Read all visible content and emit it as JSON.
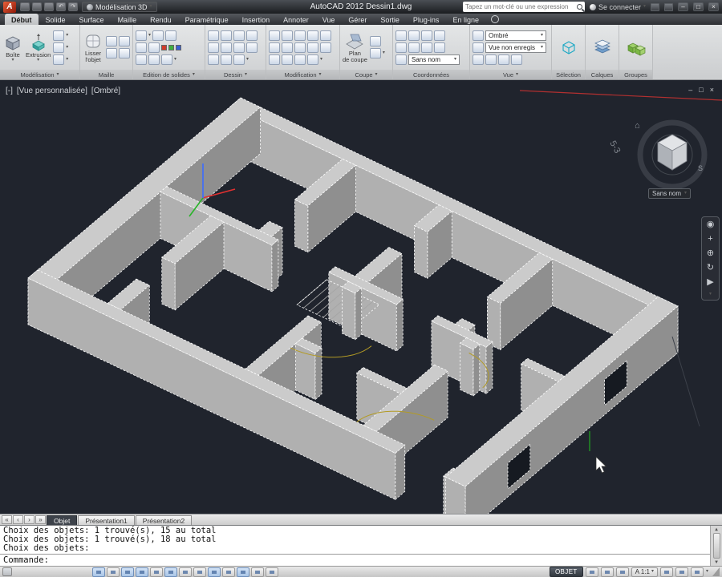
{
  "title_bar": {
    "workspace": "Modélisation 3D",
    "app_name": "AutoCAD 2012",
    "doc_name": "Dessin1.dwg",
    "search_placeholder": "Tapez un mot-clé ou une expression",
    "sign_in": "Se connecter"
  },
  "ribbon": {
    "tabs": [
      "Début",
      "Solide",
      "Surface",
      "Maille",
      "Rendu",
      "Paramétrique",
      "Insertion",
      "Annoter",
      "Vue",
      "Gérer",
      "Sortie",
      "Plug-ins",
      "En ligne"
    ],
    "panels": {
      "modelisation": {
        "label": "Modélisation",
        "box": "Boîte",
        "extrusion": "Extrusion"
      },
      "maille": {
        "label": "Maille",
        "smooth_line1": "Lisser",
        "smooth_line2": "l'objet"
      },
      "edition": {
        "label": "Edition de solides"
      },
      "dessin": {
        "label": "Dessin"
      },
      "modification": {
        "label": "Modification"
      },
      "coupe": {
        "label": "Coupe",
        "section_line1": "Plan",
        "section_line2": "de coupe"
      },
      "coordonnees": {
        "label": "Coordonnées",
        "ucs_value": "Sans nom"
      },
      "vue": {
        "label": "Vue",
        "visual_style": "Ombré",
        "named_view": "Vue non enregis"
      },
      "selection": {
        "label": "Sélection"
      },
      "calques": {
        "label": "Calques"
      },
      "groupes": {
        "label": "Groupes"
      }
    }
  },
  "viewport": {
    "controls_label": "[-]",
    "view_label": "[Vue personnalisée]",
    "style_label": "[Ombré]",
    "section_label": "5-3",
    "ucs_tag": "Sans nom",
    "compass_s": "S"
  },
  "layout_tabs": {
    "items": [
      "Objet",
      "Présentation1",
      "Présentation2"
    ]
  },
  "command": {
    "lines": [
      "Choix des objets: 1 trouvé(s), 15 au total",
      "Choix des objets: 1 trouvé(s), 18 au total",
      "Choix des objets:"
    ],
    "prompt": "Commande:"
  },
  "status_bar": {
    "model_label": "OBJET",
    "scale_label": "A 1:1"
  },
  "icons": {
    "caret": "▾",
    "minimize": "–",
    "maximize": "□",
    "close": "×",
    "undo": "↶",
    "redo": "↷",
    "home": "⌂",
    "nav_wheel": "◉",
    "nav_pan": "+",
    "nav_zoom": "⊕",
    "nav_orbit": "↻",
    "nav_motion": "▶",
    "arrow_first": "«",
    "arrow_prev": "‹",
    "arrow_next": "›",
    "arrow_last": "»",
    "scroll_up": "▲",
    "scroll_down": "▼"
  },
  "colors": {
    "viewport_bg": "#20242d",
    "wall_top": "#cbcbcb",
    "selection_dash": "#ffffff",
    "door_arc": "#b39b25",
    "section_line": "#b23030"
  }
}
